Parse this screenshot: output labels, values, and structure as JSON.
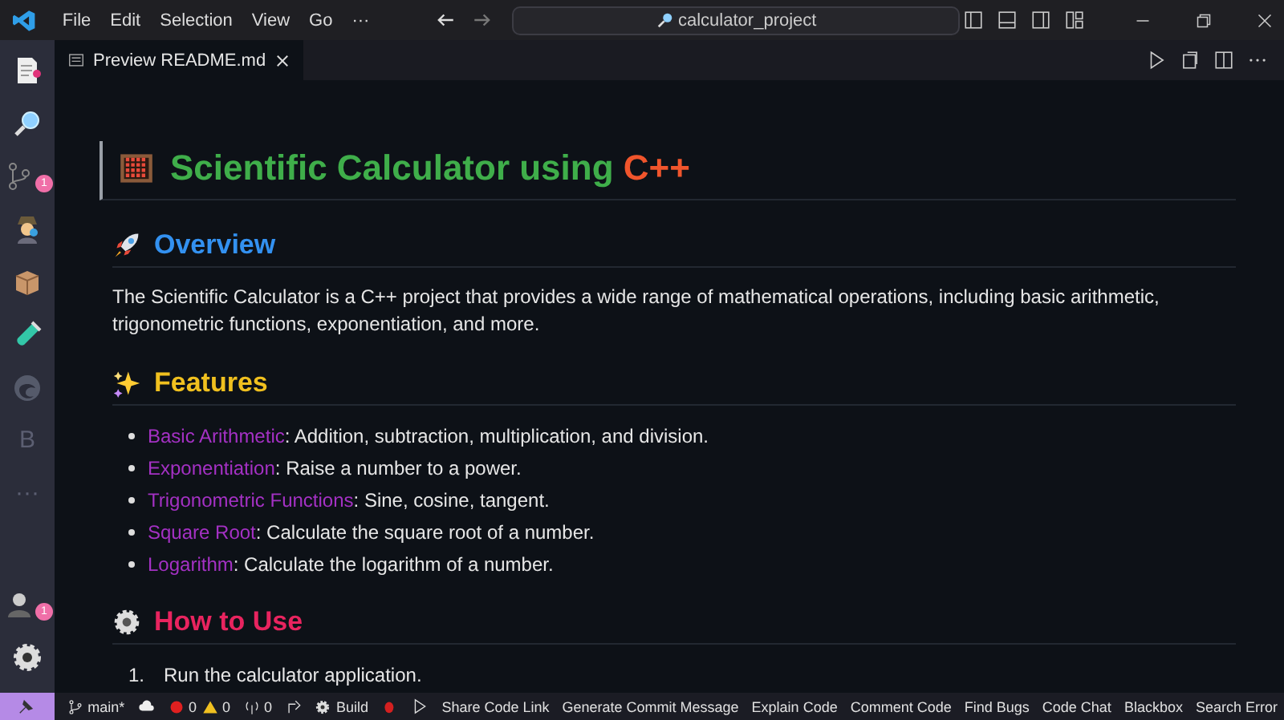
{
  "menu": [
    "File",
    "Edit",
    "Selection",
    "View",
    "Go",
    "···"
  ],
  "search": {
    "value": "calculator_project"
  },
  "tabs": [
    {
      "label": "Preview README.md",
      "selected": true
    }
  ],
  "activity": [
    {
      "kind": "file"
    },
    {
      "kind": "search"
    },
    {
      "kind": "branch",
      "badge": "1"
    },
    {
      "kind": "detective"
    },
    {
      "kind": "box"
    },
    {
      "kind": "tube"
    },
    {
      "kind": "swirl"
    },
    {
      "kind": "letter",
      "text": "B"
    },
    {
      "kind": "more",
      "text": "···"
    }
  ],
  "activity_bottom": [
    {
      "kind": "account",
      "badge": "1"
    },
    {
      "kind": "gear"
    }
  ],
  "doc": {
    "title": {
      "main": "Scientific Calculator using",
      "accent": "C++"
    },
    "sections": [
      {
        "kind": "paragraph",
        "heading": "Overview",
        "color": "#3391f0",
        "text": "The Scientific Calculator is a C++ project that provides a wide range of mathematical operations, including basic arithmetic, trigonometric functions, exponentiation, and more."
      },
      {
        "kind": "bullets",
        "heading": "Features",
        "color": "#f0c01f",
        "items": [
          {
            "term": "Basic Arithmetic",
            "text": ": Addition, subtraction, multiplication, and division."
          },
          {
            "term": "Exponentiation",
            "text": ": Raise a number to a power."
          },
          {
            "term": "Trigonometric Functions",
            "text": ": Sine, cosine, tangent."
          },
          {
            "term": "Square Root",
            "text": ": Calculate the square root of a number."
          },
          {
            "term": "Logarithm",
            "text": ": Calculate the logarithm of a number."
          }
        ]
      },
      {
        "kind": "numbered",
        "heading": "How to Use",
        "color": "#e8245f",
        "items": [
          {
            "number": "1.",
            "text": "Run the calculator application."
          }
        ]
      }
    ]
  },
  "status": {
    "branch": "main*",
    "errors": "0",
    "warnings": "0",
    "ports": "0",
    "build": "Build",
    "actions": [
      "Share Code Link",
      "Generate Commit Message",
      "Explain Code",
      "Comment Code",
      "Find Bugs",
      "Code Chat",
      "Blackbox",
      "Search Error"
    ]
  }
}
